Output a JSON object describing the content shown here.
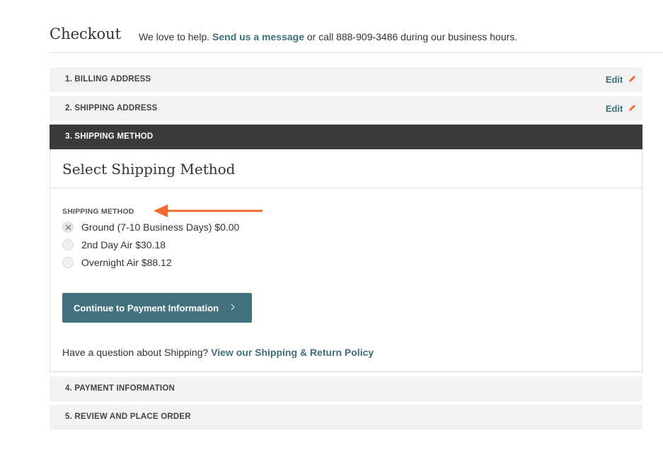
{
  "header": {
    "title": "Checkout",
    "intro_prefix": "We love to help.",
    "intro_link": "Send us a message",
    "intro_suffix": "or call 888-909-3486 during our business hours."
  },
  "steps": [
    {
      "label": "1. BILLING ADDRESS",
      "edit": "Edit"
    },
    {
      "label": "2. SHIPPING ADDRESS",
      "edit": "Edit"
    },
    {
      "label": "3. SHIPPING METHOD"
    },
    {
      "label": "4. PAYMENT INFORMATION"
    },
    {
      "label": "5. REVIEW AND PLACE ORDER"
    }
  ],
  "shipping": {
    "panel_title": "Select Shipping Method",
    "field_label": "SHIPPING METHOD",
    "options": [
      {
        "label": "Ground (7-10 Business Days) $0.00",
        "selected": true
      },
      {
        "label": "2nd Day Air $30.18",
        "selected": false
      },
      {
        "label": "Overnight Air $88.12",
        "selected": false
      }
    ],
    "continue_label": "Continue to Payment Information",
    "question_prefix": "Have a question about Shipping?",
    "question_link": "View our Shipping & Return Policy"
  },
  "colors": {
    "accent": "#44717e",
    "link": "#3d6f7c",
    "active_step": "#3b3b3b",
    "annotation_arrow": "#f26a2e",
    "edit_pencil": "#f26a2e"
  },
  "icons": {
    "pencil": "pencil-icon",
    "arrow": "annotation-arrow",
    "chevron": "chevron-right-icon",
    "radio_checked": "x-mark-icon"
  }
}
